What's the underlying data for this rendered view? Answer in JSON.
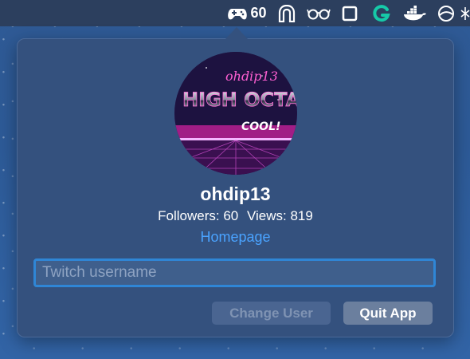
{
  "menubar": {
    "twitch_count": "60",
    "icons": [
      "gamepad-icon",
      "arch-icon",
      "glasses-icon",
      "square-icon",
      "grammarly-icon",
      "docker-icon",
      "globe-icon",
      "extra-icon"
    ]
  },
  "profile": {
    "avatar_text_top": "ohdip13",
    "avatar_text_main": "HIGH OCTA",
    "avatar_text_sub": "COOL!",
    "username": "ohdip13",
    "followers_label": "Followers: 60",
    "views_label": "Views: 819",
    "homepage_label": "Homepage"
  },
  "form": {
    "username_placeholder": "Twitch username",
    "username_value": ""
  },
  "buttons": {
    "change_user": "Change User",
    "quit_app": "Quit App"
  },
  "colors": {
    "accent": "#4aa3ff",
    "focus_ring": "#2f86d6",
    "popover_bg": "#34517e"
  }
}
